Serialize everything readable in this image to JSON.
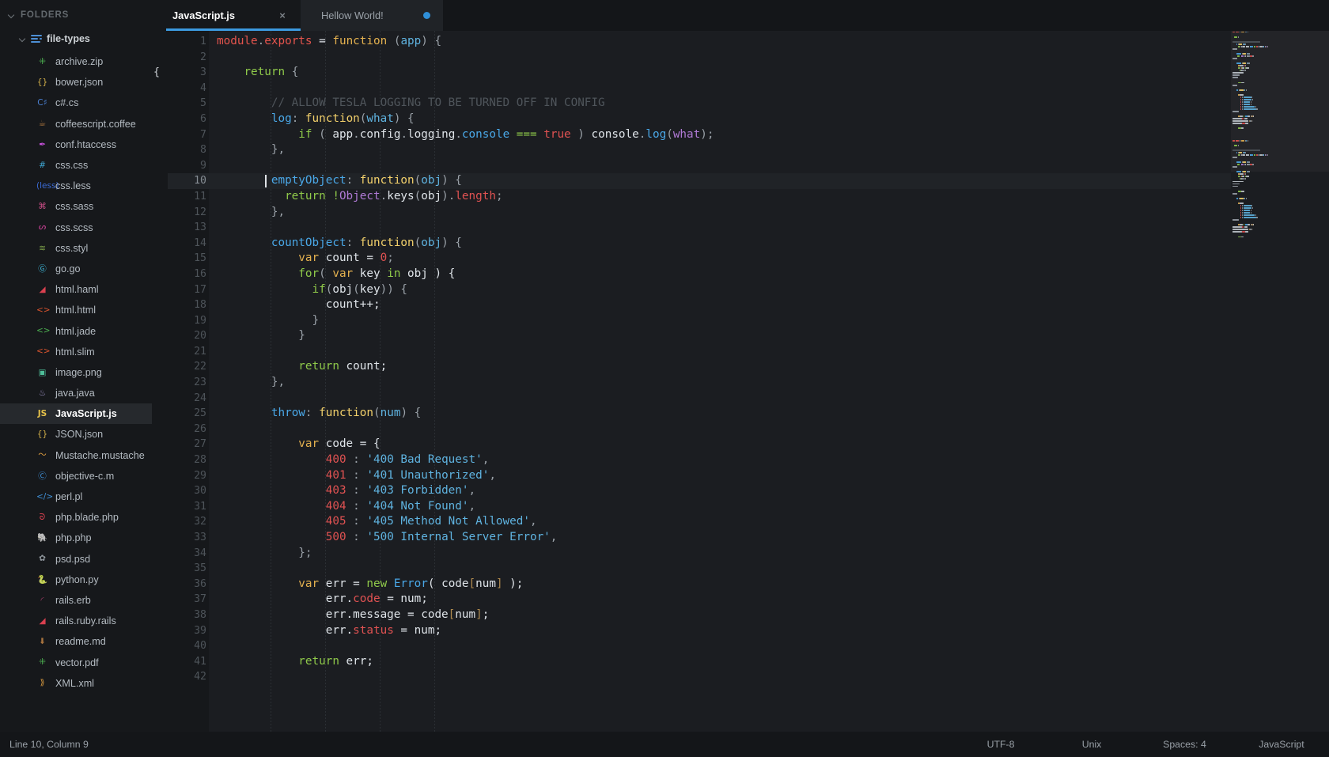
{
  "sidebar": {
    "header": "FOLDERS",
    "folder": "file-types",
    "files": [
      {
        "name": "archive.zip",
        "glyph": "⁜",
        "color": "#4caf50"
      },
      {
        "name": "bower.json",
        "glyph": "{}",
        "color": "#d6b24a"
      },
      {
        "name": "c#.cs",
        "glyph": "C♯",
        "color": "#4a7fd0"
      },
      {
        "name": "coffeescript.coffee",
        "glyph": "☕",
        "color": "#a9743f"
      },
      {
        "name": "conf.htaccess",
        "glyph": "✒",
        "color": "#c24fd6"
      },
      {
        "name": "css.css",
        "glyph": "#",
        "color": "#3fa9d6"
      },
      {
        "name": "css.less",
        "glyph": "(less)",
        "color": "#3b6bd6"
      },
      {
        "name": "css.sass",
        "glyph": "⌘",
        "color": "#d04f8a"
      },
      {
        "name": "css.scss",
        "glyph": "ᔕ",
        "color": "#d0429a"
      },
      {
        "name": "css.styl",
        "glyph": "≋",
        "color": "#7fa34a"
      },
      {
        "name": "go.go",
        "glyph": "Ⓖ",
        "color": "#3fb5d6"
      },
      {
        "name": "html.haml",
        "glyph": "◢",
        "color": "#d9404f"
      },
      {
        "name": "html.html",
        "glyph": "<>",
        "color": "#d9542e"
      },
      {
        "name": "html.jade",
        "glyph": "<>",
        "color": "#4caf50"
      },
      {
        "name": "html.slim",
        "glyph": "<>",
        "color": "#d9542e"
      },
      {
        "name": "image.png",
        "glyph": "▣",
        "color": "#4fbf9a"
      },
      {
        "name": "java.java",
        "glyph": "♨",
        "color": "#9a8fbf"
      },
      {
        "name": "JavaScript.js",
        "glyph": "JS",
        "color": "#e4c04a",
        "active": true
      },
      {
        "name": "JSON.json",
        "glyph": "{}",
        "color": "#d6b24a"
      },
      {
        "name": "Mustache.mustache",
        "glyph": "〜",
        "color": "#d99a3f"
      },
      {
        "name": "objective-c.m",
        "glyph": "Ⓒ",
        "color": "#3f8fd6"
      },
      {
        "name": "perl.pl",
        "glyph": "</>",
        "color": "#3f8fd6"
      },
      {
        "name": "php.blade.php",
        "glyph": "ᘐ",
        "color": "#d9404f"
      },
      {
        "name": "php.php",
        "glyph": "🐘",
        "color": "#7b6fd0"
      },
      {
        "name": "psd.psd",
        "glyph": "✿",
        "color": "#8f969c"
      },
      {
        "name": "python.py",
        "glyph": "🐍",
        "color": "#3f8fd6"
      },
      {
        "name": "rails.erb",
        "glyph": "◜",
        "color": "#b0406f"
      },
      {
        "name": "rails.ruby.rails",
        "glyph": "◢",
        "color": "#d9404f"
      },
      {
        "name": "readme.md",
        "glyph": "⬇",
        "color": "#a9743f"
      },
      {
        "name": "vector.pdf",
        "glyph": "⁜",
        "color": "#4caf50"
      },
      {
        "name": "XML.xml",
        "glyph": "⟫",
        "color": "#d99a3f"
      }
    ]
  },
  "tabs": [
    {
      "label": "JavaScript.js",
      "close": "×",
      "active": true
    },
    {
      "label": "Hellow World!",
      "dirty": true
    }
  ],
  "status": {
    "position": "Line 10, Column 9",
    "encoding": "UTF-8",
    "line_endings": "Unix",
    "indent": "Spaces: 4",
    "language": "JavaScript"
  },
  "editor": {
    "active_line": 10,
    "lines": [
      {
        "n": 1,
        "fold": true,
        "tokens": [
          {
            "t": "module",
            "c": "t-key"
          },
          {
            "t": ".",
            "c": "t-punc"
          },
          {
            "t": "exports",
            "c": "t-key"
          },
          {
            "t": " = ",
            "c": "t-plain"
          },
          {
            "t": "function",
            "c": "t-kw"
          },
          {
            "t": " (",
            "c": "t-punc"
          },
          {
            "t": "app",
            "c": "t-param"
          },
          {
            "t": ") {",
            "c": "t-punc"
          }
        ]
      },
      {
        "n": 2,
        "tokens": []
      },
      {
        "n": 3,
        "fold": true,
        "bracket": "{",
        "tokens": [
          {
            "t": "    ",
            "c": "t-plain"
          },
          {
            "t": "return",
            "c": "t-ctl"
          },
          {
            "t": " ",
            "c": "t-plain"
          },
          {
            "t": "{",
            "c": "t-punc"
          }
        ]
      },
      {
        "n": 4,
        "tokens": []
      },
      {
        "n": 5,
        "tokens": [
          {
            "t": "        // ALLOW TESLA LOGGING TO BE TURNED OFF IN CONFIG",
            "c": "t-com"
          }
        ]
      },
      {
        "n": 6,
        "tokens": [
          {
            "t": "        ",
            "c": "t-plain"
          },
          {
            "t": "log",
            "c": "t-prop"
          },
          {
            "t": ": ",
            "c": "t-punc"
          },
          {
            "t": "function",
            "c": "t-fn"
          },
          {
            "t": "(",
            "c": "t-punc"
          },
          {
            "t": "what",
            "c": "t-param"
          },
          {
            "t": ") {",
            "c": "t-punc"
          }
        ]
      },
      {
        "n": 7,
        "tokens": [
          {
            "t": "            ",
            "c": "t-plain"
          },
          {
            "t": "if",
            "c": "t-ctl"
          },
          {
            "t": " ( ",
            "c": "t-punc"
          },
          {
            "t": "app",
            "c": "t-plain"
          },
          {
            "t": ".",
            "c": "t-punc"
          },
          {
            "t": "config",
            "c": "t-plain"
          },
          {
            "t": ".",
            "c": "t-punc"
          },
          {
            "t": "logging",
            "c": "t-plain"
          },
          {
            "t": ".",
            "c": "t-punc"
          },
          {
            "t": "console",
            "c": "t-prop"
          },
          {
            "t": " ",
            "c": "t-plain"
          },
          {
            "t": "===",
            "c": "t-op"
          },
          {
            "t": " ",
            "c": "t-plain"
          },
          {
            "t": "true",
            "c": "t-true"
          },
          {
            "t": " ) ",
            "c": "t-punc"
          },
          {
            "t": "console",
            "c": "t-plain"
          },
          {
            "t": ".",
            "c": "t-punc"
          },
          {
            "t": "log",
            "c": "t-prop"
          },
          {
            "t": "(",
            "c": "t-punc"
          },
          {
            "t": "what",
            "c": "t-class"
          },
          {
            "t": ");",
            "c": "t-punc"
          }
        ]
      },
      {
        "n": 8,
        "tokens": [
          {
            "t": "        },",
            "c": "t-punc"
          }
        ]
      },
      {
        "n": 9,
        "tokens": []
      },
      {
        "n": 10,
        "tokens": [
          {
            "t": "        ",
            "c": "t-plain"
          },
          {
            "t": "emptyObject",
            "c": "t-prop"
          },
          {
            "t": ": ",
            "c": "t-punc"
          },
          {
            "t": "function",
            "c": "t-fn"
          },
          {
            "t": "(",
            "c": "t-punc"
          },
          {
            "t": "obj",
            "c": "t-param"
          },
          {
            "t": ") {",
            "c": "t-punc"
          }
        ]
      },
      {
        "n": 11,
        "tokens": [
          {
            "t": "          ",
            "c": "t-plain"
          },
          {
            "t": "return",
            "c": "t-ctl"
          },
          {
            "t": " ",
            "c": "t-plain"
          },
          {
            "t": "!",
            "c": "t-op"
          },
          {
            "t": "Object",
            "c": "t-class"
          },
          {
            "t": ".",
            "c": "t-punc"
          },
          {
            "t": "keys",
            "c": "t-plain"
          },
          {
            "t": "(",
            "c": "t-punc"
          },
          {
            "t": "obj",
            "c": "t-plain"
          },
          {
            "t": ").",
            "c": "t-punc"
          },
          {
            "t": "length",
            "c": "t-num"
          },
          {
            "t": ";",
            "c": "t-punc"
          }
        ]
      },
      {
        "n": 12,
        "tokens": [
          {
            "t": "        },",
            "c": "t-punc"
          }
        ]
      },
      {
        "n": 13,
        "tokens": []
      },
      {
        "n": 14,
        "fold": true,
        "tokens": [
          {
            "t": "        ",
            "c": "t-plain"
          },
          {
            "t": "countObject",
            "c": "t-prop"
          },
          {
            "t": ": ",
            "c": "t-punc"
          },
          {
            "t": "function",
            "c": "t-fn"
          },
          {
            "t": "(",
            "c": "t-punc"
          },
          {
            "t": "obj",
            "c": "t-param"
          },
          {
            "t": ") {",
            "c": "t-punc"
          }
        ]
      },
      {
        "n": 15,
        "tokens": [
          {
            "t": "            ",
            "c": "t-plain"
          },
          {
            "t": "var",
            "c": "t-kw"
          },
          {
            "t": " count = ",
            "c": "t-plain"
          },
          {
            "t": "0",
            "c": "t-num"
          },
          {
            "t": ";",
            "c": "t-punc"
          }
        ]
      },
      {
        "n": 16,
        "fold": true,
        "tokens": [
          {
            "t": "            ",
            "c": "t-plain"
          },
          {
            "t": "for",
            "c": "t-ctl"
          },
          {
            "t": "( ",
            "c": "t-punc"
          },
          {
            "t": "var",
            "c": "t-kw"
          },
          {
            "t": " key ",
            "c": "t-plain"
          },
          {
            "t": "in",
            "c": "t-ctl"
          },
          {
            "t": " obj ) {",
            "c": "t-plain"
          }
        ]
      },
      {
        "n": 17,
        "tokens": [
          {
            "t": "              ",
            "c": "t-plain"
          },
          {
            "t": "if",
            "c": "t-ctl"
          },
          {
            "t": "(",
            "c": "t-punc"
          },
          {
            "t": "obj",
            "c": "t-plain"
          },
          {
            "t": "(",
            "c": "t-punc"
          },
          {
            "t": "key",
            "c": "t-plain"
          },
          {
            "t": ")) {",
            "c": "t-punc"
          }
        ]
      },
      {
        "n": 18,
        "tokens": [
          {
            "t": "                count++;",
            "c": "t-plain"
          }
        ]
      },
      {
        "n": 19,
        "tokens": [
          {
            "t": "              }",
            "c": "t-punc"
          }
        ]
      },
      {
        "n": 20,
        "tokens": [
          {
            "t": "            }",
            "c": "t-punc"
          }
        ]
      },
      {
        "n": 21,
        "tokens": []
      },
      {
        "n": 22,
        "tokens": [
          {
            "t": "            ",
            "c": "t-plain"
          },
          {
            "t": "return",
            "c": "t-ctl"
          },
          {
            "t": " count;",
            "c": "t-plain"
          }
        ]
      },
      {
        "n": 23,
        "tokens": [
          {
            "t": "        },",
            "c": "t-punc"
          }
        ]
      },
      {
        "n": 24,
        "tokens": []
      },
      {
        "n": 25,
        "fold": true,
        "tokens": [
          {
            "t": "        ",
            "c": "t-plain"
          },
          {
            "t": "throw",
            "c": "t-prop"
          },
          {
            "t": ": ",
            "c": "t-punc"
          },
          {
            "t": "function",
            "c": "t-fn"
          },
          {
            "t": "(",
            "c": "t-punc"
          },
          {
            "t": "num",
            "c": "t-param"
          },
          {
            "t": ") {",
            "c": "t-punc"
          }
        ]
      },
      {
        "n": 26,
        "tokens": []
      },
      {
        "n": 27,
        "fold": true,
        "tokens": [
          {
            "t": "            ",
            "c": "t-plain"
          },
          {
            "t": "var",
            "c": "t-kw"
          },
          {
            "t": " code = {",
            "c": "t-plain"
          }
        ]
      },
      {
        "n": 28,
        "tokens": [
          {
            "t": "                ",
            "c": "t-plain"
          },
          {
            "t": "400",
            "c": "t-num"
          },
          {
            "t": " : ",
            "c": "t-punc"
          },
          {
            "t": "'400 Bad Request'",
            "c": "t-str"
          },
          {
            "t": ",",
            "c": "t-punc"
          }
        ]
      },
      {
        "n": 29,
        "tokens": [
          {
            "t": "                ",
            "c": "t-plain"
          },
          {
            "t": "401",
            "c": "t-num"
          },
          {
            "t": " : ",
            "c": "t-punc"
          },
          {
            "t": "'401 Unauthorized'",
            "c": "t-str"
          },
          {
            "t": ",",
            "c": "t-punc"
          }
        ]
      },
      {
        "n": 30,
        "tokens": [
          {
            "t": "                ",
            "c": "t-plain"
          },
          {
            "t": "403",
            "c": "t-num"
          },
          {
            "t": " : ",
            "c": "t-punc"
          },
          {
            "t": "'403 Forbidden'",
            "c": "t-str"
          },
          {
            "t": ",",
            "c": "t-punc"
          }
        ]
      },
      {
        "n": 31,
        "tokens": [
          {
            "t": "                ",
            "c": "t-plain"
          },
          {
            "t": "404",
            "c": "t-num"
          },
          {
            "t": " : ",
            "c": "t-punc"
          },
          {
            "t": "'404 Not Found'",
            "c": "t-str"
          },
          {
            "t": ",",
            "c": "t-punc"
          }
        ]
      },
      {
        "n": 32,
        "tokens": [
          {
            "t": "                ",
            "c": "t-plain"
          },
          {
            "t": "405",
            "c": "t-num"
          },
          {
            "t": " : ",
            "c": "t-punc"
          },
          {
            "t": "'405 Method Not Allowed'",
            "c": "t-str"
          },
          {
            "t": ",",
            "c": "t-punc"
          }
        ]
      },
      {
        "n": 33,
        "tokens": [
          {
            "t": "                ",
            "c": "t-plain"
          },
          {
            "t": "500",
            "c": "t-num"
          },
          {
            "t": " : ",
            "c": "t-punc"
          },
          {
            "t": "'500 Internal Server Error'",
            "c": "t-str"
          },
          {
            "t": ",",
            "c": "t-punc"
          }
        ]
      },
      {
        "n": 34,
        "tokens": [
          {
            "t": "            };",
            "c": "t-punc"
          }
        ]
      },
      {
        "n": 35,
        "tokens": []
      },
      {
        "n": 36,
        "fold": true,
        "tokens": [
          {
            "t": "            ",
            "c": "t-plain"
          },
          {
            "t": "var",
            "c": "t-kw"
          },
          {
            "t": " err = ",
            "c": "t-plain"
          },
          {
            "t": "new",
            "c": "t-ctl"
          },
          {
            "t": " ",
            "c": "t-plain"
          },
          {
            "t": "Error",
            "c": "t-prop"
          },
          {
            "t": "( code",
            "c": "t-plain"
          },
          {
            "t": "[",
            "c": "t-brack"
          },
          {
            "t": "num",
            "c": "t-plain"
          },
          {
            "t": "]",
            "c": "t-brack"
          },
          {
            "t": " );",
            "c": "t-plain"
          }
        ]
      },
      {
        "n": 37,
        "tokens": [
          {
            "t": "                err.",
            "c": "t-plain"
          },
          {
            "t": "code",
            "c": "t-num"
          },
          {
            "t": " = num;",
            "c": "t-plain"
          }
        ]
      },
      {
        "n": 38,
        "tokens": [
          {
            "t": "                err.message = code",
            "c": "t-plain"
          },
          {
            "t": "[",
            "c": "t-brack"
          },
          {
            "t": "num",
            "c": "t-plain"
          },
          {
            "t": "]",
            "c": "t-brack"
          },
          {
            "t": ";",
            "c": "t-plain"
          }
        ]
      },
      {
        "n": 39,
        "tokens": [
          {
            "t": "                err.",
            "c": "t-plain"
          },
          {
            "t": "status",
            "c": "t-num"
          },
          {
            "t": " = num;",
            "c": "t-plain"
          }
        ]
      },
      {
        "n": 40,
        "tokens": []
      },
      {
        "n": 41,
        "tokens": [
          {
            "t": "            ",
            "c": "t-plain"
          },
          {
            "t": "return",
            "c": "t-ctl"
          },
          {
            "t": " err;",
            "c": "t-plain"
          }
        ]
      },
      {
        "n": 42,
        "tokens": []
      }
    ]
  }
}
